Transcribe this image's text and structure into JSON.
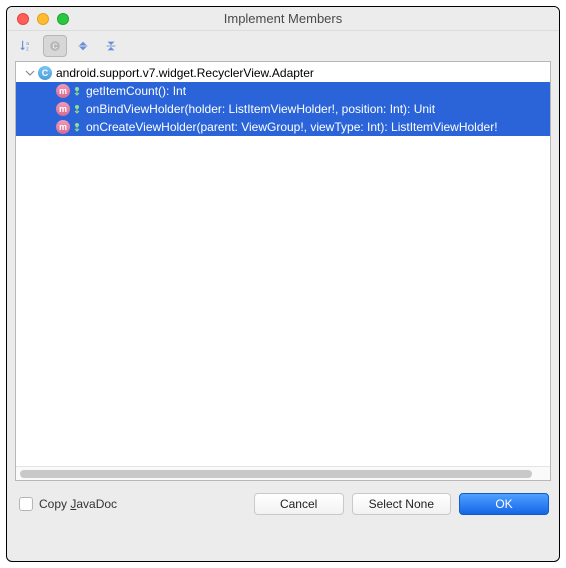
{
  "window": {
    "title": "Implement Members"
  },
  "toolbar": {
    "sort": "sort-alpha-icon",
    "by_class": "group-by-class-icon",
    "expand": "expand-all-icon",
    "collapse": "collapse-all-icon"
  },
  "tree": {
    "parent": {
      "label": "android.support.v7.widget.RecyclerView.Adapter",
      "icon": "C"
    },
    "members": [
      {
        "icon": "m",
        "label": "getItemCount(): Int"
      },
      {
        "icon": "m",
        "label": "onBindViewHolder(holder: ListItemViewHolder!, position: Int): Unit"
      },
      {
        "icon": "m",
        "label": "onCreateViewHolder(parent: ViewGroup!, viewType: Int): ListItemViewHolder!"
      }
    ]
  },
  "footer": {
    "copy_javadoc_prefix": "Copy ",
    "copy_javadoc_hotkey": "J",
    "copy_javadoc_suffix": "avaDoc",
    "cancel": "Cancel",
    "select_none": "Select None",
    "ok": "OK"
  }
}
